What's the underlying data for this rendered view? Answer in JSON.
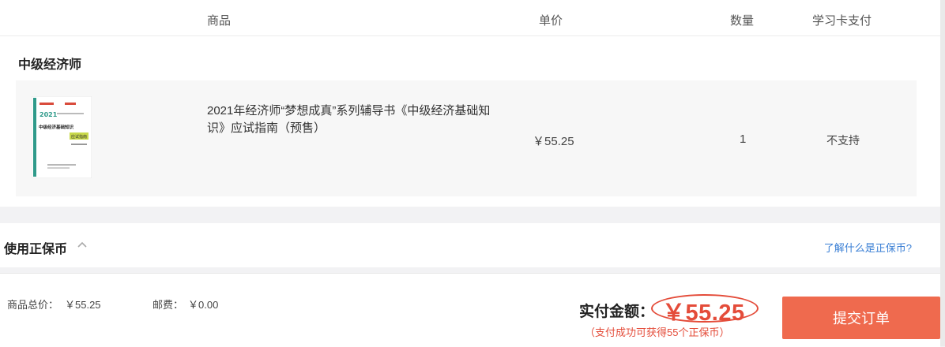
{
  "table_header": {
    "product": "商品",
    "unit_price": "单价",
    "quantity": "数量",
    "card_payment": "学习卡支付"
  },
  "shop": {
    "name": "中级经济师"
  },
  "product": {
    "title": "2021年经济师“梦想成真”系列辅导书《中级经济基础知识》应试指南（预售）",
    "price": "￥55.25",
    "quantity": "1",
    "card_payment": "不支持",
    "cover": {
      "line_year": "2021",
      "line_title": "中级经济基础知识",
      "badge": "应试指南"
    }
  },
  "coin": {
    "label": "使用正保币",
    "link": "了解什么是正保币?"
  },
  "footer": {
    "total_label": "商品总价：",
    "total_value": "￥55.25",
    "shipping_label": "邮费：",
    "shipping_value": "￥0.00",
    "pay_label": "实付金额：",
    "pay_amount": "￥55.25",
    "pay_note": "（支付成功可获得55个正保币）",
    "submit_label": "提交订单"
  },
  "colors": {
    "accent": "#e44c3a",
    "button": "#ef6a4e",
    "link": "#3a7fd5"
  }
}
